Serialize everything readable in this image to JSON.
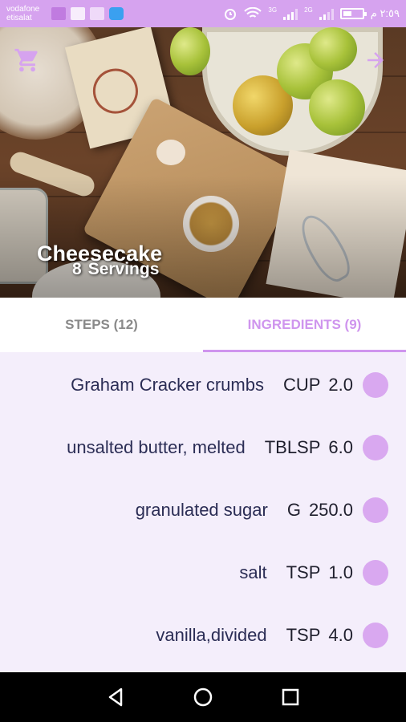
{
  "status_bar": {
    "carrier_line1": "vodafone",
    "carrier_line2": "etisalat",
    "network_label_1": "3G",
    "network_label_2": "2G",
    "time": "٢:٥٩ م"
  },
  "hero": {
    "recipe_name": "Cheesecake",
    "servings_count": "8",
    "servings_label": "Servings"
  },
  "tabs": [
    {
      "label": "STEPS (12)",
      "active": false
    },
    {
      "label": "INGREDIENTS (9)",
      "active": true
    }
  ],
  "ingredients": [
    {
      "name": "Graham Cracker crumbs",
      "unit": "CUP",
      "quantity": "2.0"
    },
    {
      "name": "unsalted butter, melted",
      "unit": "TBLSP",
      "quantity": "6.0"
    },
    {
      "name": "granulated sugar",
      "unit": "G",
      "quantity": "250.0"
    },
    {
      "name": "salt",
      "unit": "TSP",
      "quantity": "1.0"
    },
    {
      "name": "vanilla,divided",
      "unit": "TSP",
      "quantity": "4.0"
    }
  ],
  "colors": {
    "accent": "#d6a3ef",
    "tab_active": "#cf95ee",
    "list_bg": "#f4eefb",
    "dot": "#d9a8f0"
  },
  "icons": {
    "cart": "shopping-cart-icon",
    "forward": "arrow-forward-icon",
    "back_nav": "triangle-back-icon",
    "home_nav": "circle-home-icon",
    "recents_nav": "square-recents-icon"
  }
}
